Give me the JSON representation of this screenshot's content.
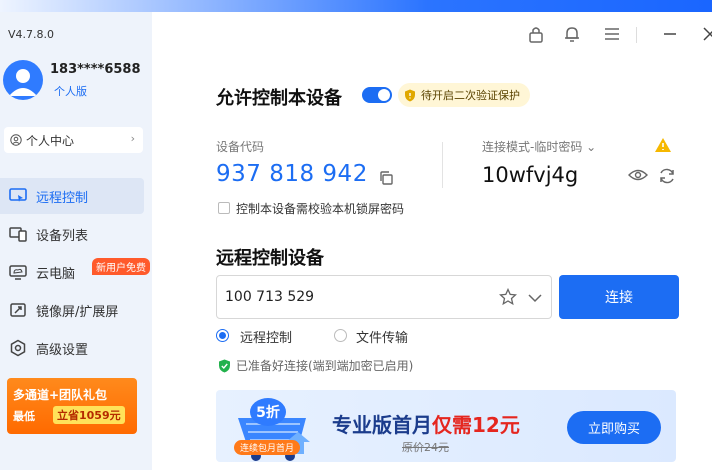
{
  "app": {
    "version": "V4.7.8.0"
  },
  "user": {
    "phone": "183****6588",
    "tier": "个人版",
    "center_label": "个人中心"
  },
  "sidebar": {
    "items": [
      {
        "label": "远程控制",
        "icon": "remote-control-icon"
      },
      {
        "label": "设备列表",
        "icon": "device-list-icon"
      },
      {
        "label": "云电脑",
        "icon": "cloud-pc-icon"
      },
      {
        "label": "镜像屏/扩展屏",
        "icon": "mirror-screen-icon"
      },
      {
        "label": "高级设置",
        "icon": "settings-icon"
      }
    ],
    "new_badge": "新用户免费"
  },
  "promo": {
    "line1": "多通道+团队礼包",
    "line2": "最低",
    "line3": "立省1059元"
  },
  "main": {
    "allow_title": "允许控制本设备",
    "allow_enabled": true,
    "verify_badge": "待开启二次验证保护",
    "device_code_label": "设备代码",
    "device_code": "937 818 942",
    "conn_mode_label": "连接模式-临时密码",
    "temp_password": "10wfvj4g",
    "lock_check_label": "控制本设备需校验本机锁屏密码",
    "remote_title": "远程控制设备",
    "input_value": "100 713 529",
    "connect_label": "连接",
    "radio_remote": "远程控制",
    "radio_file": "文件传输",
    "ready_text": "已准备好连接(端到端加密已启用)"
  },
  "banner": {
    "badge": "5折",
    "ribbon": "连续包月首月",
    "text_main": "专业版首月",
    "text_red": "仅需12元",
    "orig": "原价24元",
    "button": "立即购买"
  },
  "colors": {
    "accent": "#1c6df3",
    "promo": "#ff6a00",
    "danger": "#e5261f"
  }
}
